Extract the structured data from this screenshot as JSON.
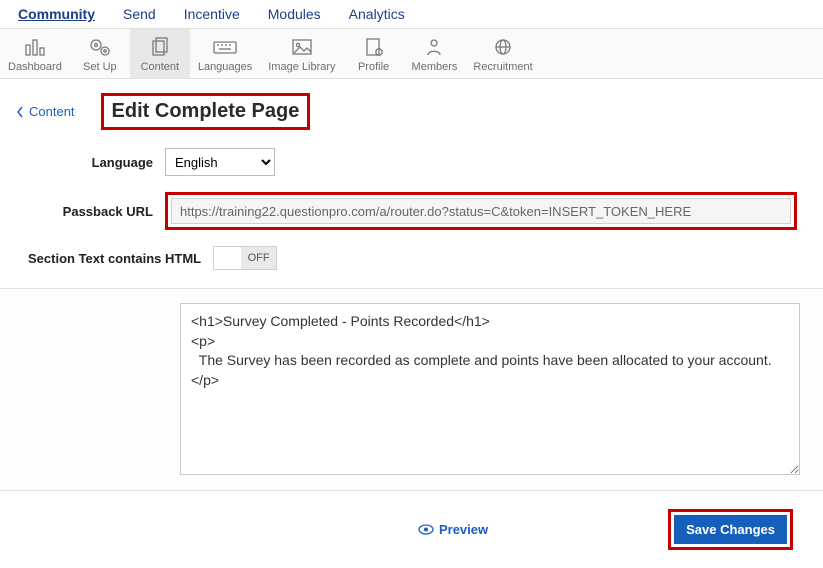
{
  "top_nav": {
    "community": "Community",
    "send": "Send",
    "incentive": "Incentive",
    "modules": "Modules",
    "analytics": "Analytics"
  },
  "toolbar": {
    "dashboard": "Dashboard",
    "setup": "Set Up",
    "content": "Content",
    "languages": "Languages",
    "image_library": "Image Library",
    "profile": "Profile",
    "members": "Members",
    "recruitment": "Recruitment"
  },
  "breadcrumb": {
    "back": "Content"
  },
  "page_title": "Edit Complete Page",
  "form": {
    "language_label": "Language",
    "language_value": "English",
    "passback_label": "Passback URL",
    "passback_value": "https://training22.questionpro.com/a/router.do?status=C&token=INSERT_TOKEN_HERE",
    "section_html_label": "Section Text contains HTML",
    "toggle_off": "OFF"
  },
  "editor_text": "<h1>Survey Completed - Points Recorded</h1>\n<p>\n  The Survey has been recorded as complete and points have been allocated to your account.\n</p>",
  "footer": {
    "preview": "Preview",
    "save": "Save Changes"
  }
}
